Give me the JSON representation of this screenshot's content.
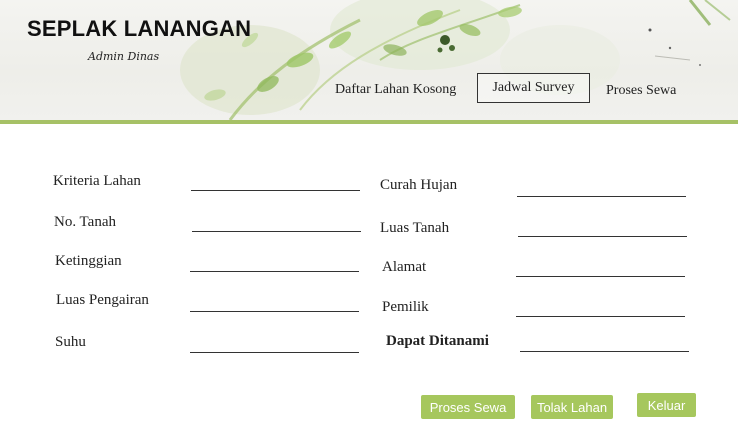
{
  "header": {
    "title": "SEPLAK LANANGAN",
    "subtitle": "Admin Dinas"
  },
  "nav": {
    "items": [
      {
        "label": "Daftar Lahan Kosong"
      },
      {
        "label": "Jadwal Survey"
      },
      {
        "label": "Proses Sewa"
      }
    ],
    "active": "Jadwal Survey"
  },
  "form": {
    "left": [
      {
        "label": "Kriteria Lahan",
        "value": ""
      },
      {
        "label": "No. Tanah",
        "value": ""
      },
      {
        "label": "Ketinggian",
        "value": ""
      },
      {
        "label": "Luas Pengairan",
        "value": ""
      },
      {
        "label": "Suhu",
        "value": ""
      }
    ],
    "right": [
      {
        "label": "Curah Hujan",
        "value": ""
      },
      {
        "label": "Luas Tanah",
        "value": ""
      },
      {
        "label": "Alamat",
        "value": ""
      },
      {
        "label": "Pemilik",
        "value": ""
      },
      {
        "label": "Dapat Ditanami",
        "value": ""
      }
    ]
  },
  "buttons": {
    "proses_sewa": "Proses Sewa",
    "tolak_lahan": "Tolak Lahan",
    "keluar": "Keluar"
  },
  "colors": {
    "accent": "#a6c75d",
    "divider": "#a6c166"
  }
}
